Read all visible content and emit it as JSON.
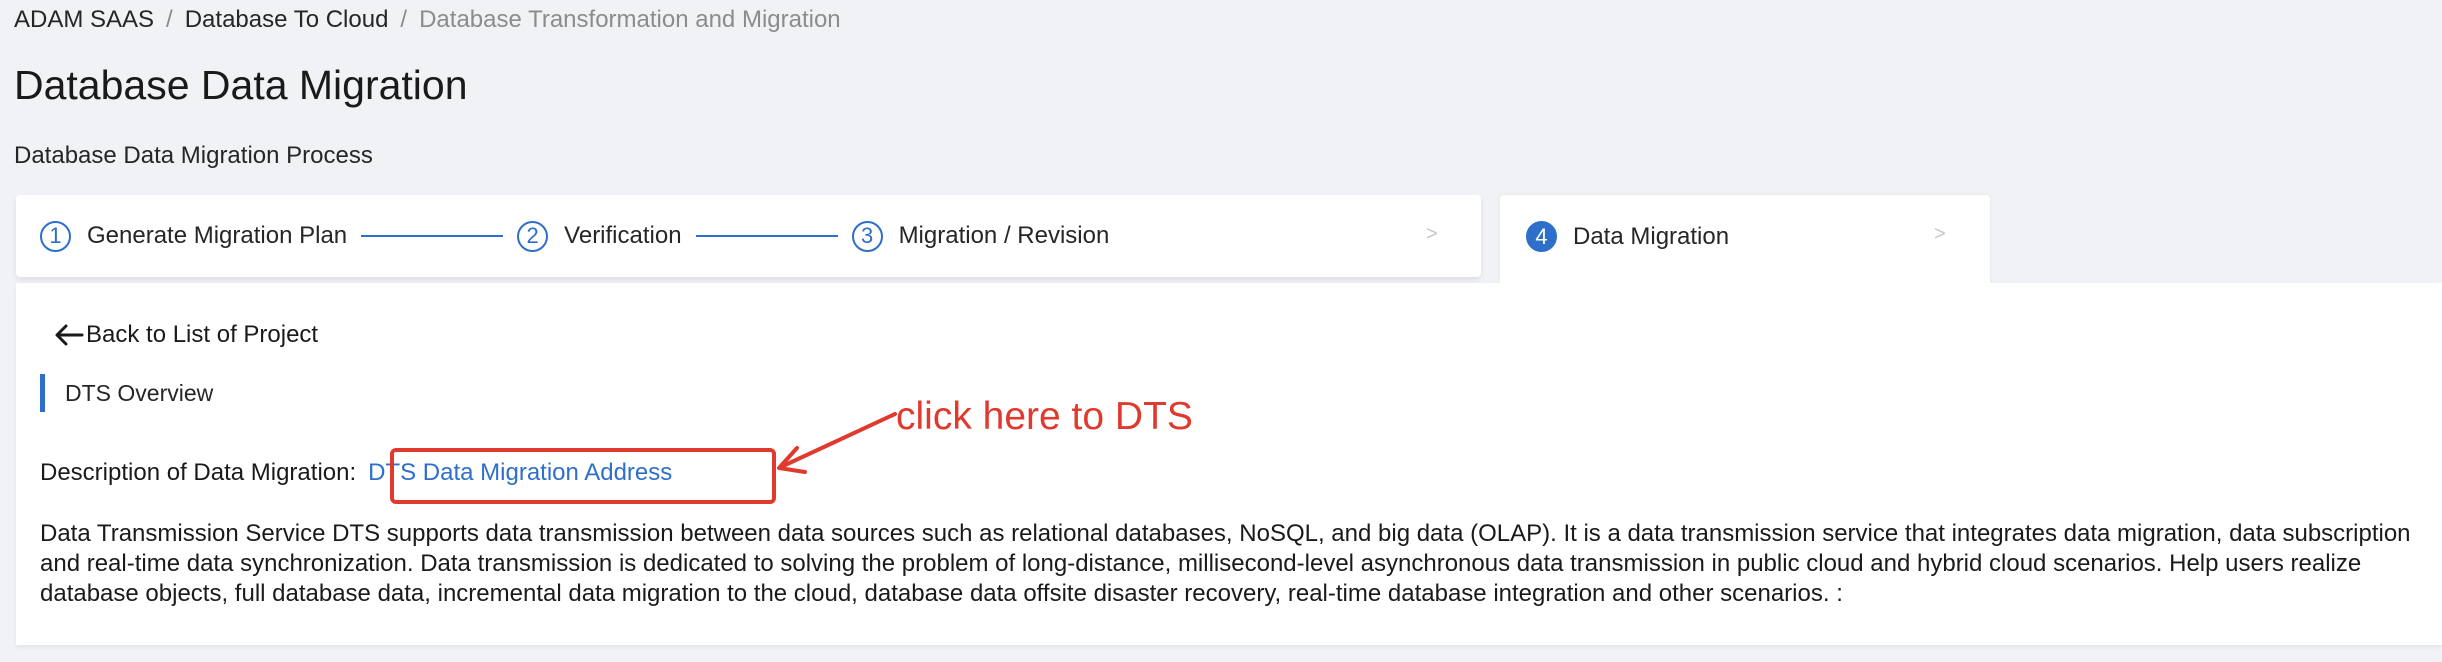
{
  "breadcrumb": {
    "items": [
      "ADAM SAAS",
      "Database To Cloud"
    ],
    "separator": "/",
    "current": "Database Transformation and Migration"
  },
  "page": {
    "title": "Database Data Migration",
    "process_label": "Database Data Migration Process"
  },
  "steps": [
    {
      "num": "1",
      "label": "Generate Migration Plan"
    },
    {
      "num": "2",
      "label": "Verification"
    },
    {
      "num": "3",
      "label": "Migration / Revision"
    },
    {
      "num": "4",
      "label": "Data Migration"
    }
  ],
  "chevron": ">",
  "back_link": {
    "label": "Back to List of Project",
    "icon": "arrow-left-icon"
  },
  "section": {
    "title": "DTS Overview"
  },
  "description": {
    "label": "Description of Data Migration:",
    "link_text": "DTS Data Migration Address",
    "body": "Data Transmission Service DTS supports data transmission between data sources such as relational databases, NoSQL, and big data (OLAP). It is a data transmission service that integrates data migration, data subscription and real-time data synchronization. Data transmission is dedicated to solving the problem of long-distance, millisecond-level asynchronous data transmission in public cloud and hybrid cloud scenarios. Help users realize database objects, full database data, incremental data migration to the cloud, database data offsite disaster recovery, real-time database integration and other scenarios. :"
  },
  "annotation": {
    "text": "click here to DTS"
  },
  "colors": {
    "accent": "#2e6fc9",
    "annotation": "#e03a2f",
    "background": "#f0f2f5"
  }
}
